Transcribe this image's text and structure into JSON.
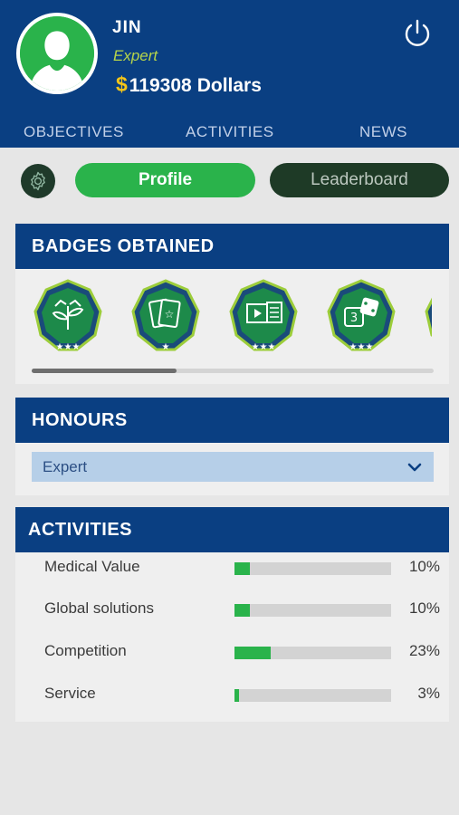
{
  "user": {
    "name": "JIN",
    "rank": "Expert",
    "currency_symbol": "$",
    "amount": "119308",
    "currency_unit": "Dollars"
  },
  "tabs": [
    {
      "label": "OBJECTIVES"
    },
    {
      "label": "ACTIVITIES"
    },
    {
      "label": "NEWS"
    }
  ],
  "buttons": {
    "profile": "Profile",
    "leaderboard": "Leaderboard"
  },
  "badges": {
    "title": "BADGES OBTAINED",
    "items": [
      {
        "icon": "plant-hands-badge-icon",
        "stars": 3
      },
      {
        "icon": "cards-star-badge-icon",
        "stars": 1
      },
      {
        "icon": "presentation-badge-icon",
        "stars": 3
      },
      {
        "icon": "dice-badge-icon",
        "stars": 3
      },
      {
        "icon": "partial-badge-icon",
        "stars": 0
      }
    ],
    "scroll_fraction_visible": 0.36
  },
  "honours": {
    "title": "HONOURS",
    "selected": "Expert"
  },
  "activities": {
    "title": "ACTIVITIES",
    "items": [
      {
        "label": "Medical Value",
        "percent_text": "10%",
        "value": 0.1
      },
      {
        "label": "Global solutions",
        "percent_text": "10%",
        "value": 0.1
      },
      {
        "label": "Competition",
        "percent_text": "23%",
        "value": 0.23
      },
      {
        "label": "Service",
        "percent_text": "3%",
        "value": 0.03
      }
    ]
  },
  "colors": {
    "brand_blue": "#0a3f82",
    "accent_green": "#2ab34b",
    "rank_yellow_green": "#b6d44a",
    "dollar_gold": "#f5c518"
  }
}
